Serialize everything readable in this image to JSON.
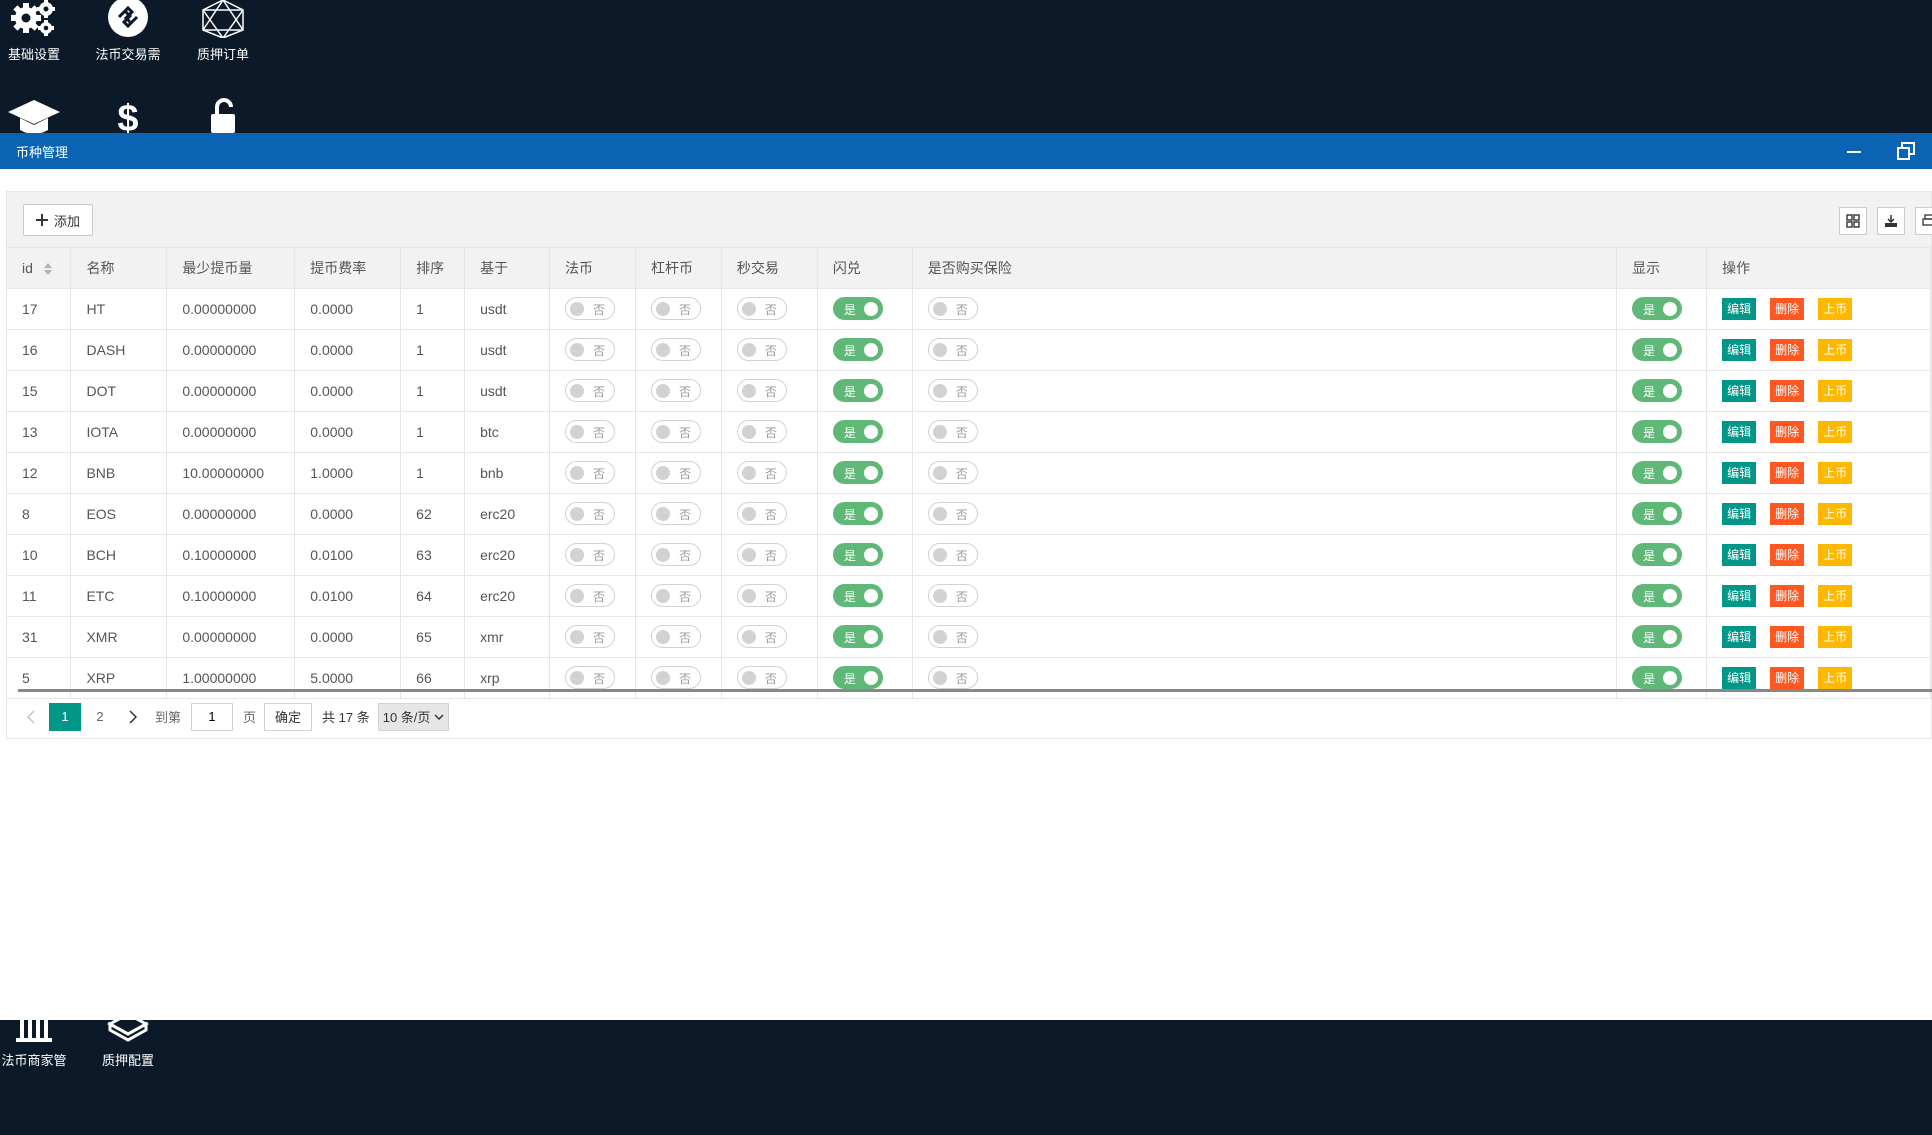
{
  "desktop": {
    "top_icons": [
      {
        "label": "基础设置",
        "icon": "gears-icon"
      },
      {
        "label": "法币交易需",
        "icon": "exchange-circle-icon"
      },
      {
        "label": "质押订单",
        "icon": "polygon-net-icon"
      }
    ],
    "second_row_icons": [
      {
        "label": "",
        "icon": "graduation-cap-icon"
      },
      {
        "label": "",
        "icon": "dollar-icon"
      },
      {
        "label": "",
        "icon": "unlock-icon"
      }
    ],
    "bottom_icons": [
      {
        "label": "法币商家管",
        "icon": "bank-icon"
      },
      {
        "label": "质押配置",
        "icon": "codepen-icon"
      }
    ]
  },
  "window": {
    "title": "币种管理",
    "add_label": "添加"
  },
  "table": {
    "columns": [
      "id",
      "名称",
      "最少提币量",
      "提币费率",
      "排序",
      "基于",
      "法币",
      "杠杆币",
      "秒交易",
      "闪兑",
      "是否购买保险",
      "显示",
      "操作"
    ],
    "switch_on": "是",
    "switch_off": "否",
    "actions": {
      "edit": "编辑",
      "delete": "删除",
      "list": "上币"
    },
    "rows": [
      {
        "id": "17",
        "name": "HT",
        "min": "0.00000000",
        "rate": "0.0000",
        "sort": "1",
        "base": "usdt"
      },
      {
        "id": "16",
        "name": "DASH",
        "min": "0.00000000",
        "rate": "0.0000",
        "sort": "1",
        "base": "usdt"
      },
      {
        "id": "15",
        "name": "DOT",
        "min": "0.00000000",
        "rate": "0.0000",
        "sort": "1",
        "base": "usdt"
      },
      {
        "id": "13",
        "name": "IOTA",
        "min": "0.00000000",
        "rate": "0.0000",
        "sort": "1",
        "base": "btc"
      },
      {
        "id": "12",
        "name": "BNB",
        "min": "10.00000000",
        "rate": "1.0000",
        "sort": "1",
        "base": "bnb"
      },
      {
        "id": "8",
        "name": "EOS",
        "min": "0.00000000",
        "rate": "0.0000",
        "sort": "62",
        "base": "erc20"
      },
      {
        "id": "10",
        "name": "BCH",
        "min": "0.10000000",
        "rate": "0.0100",
        "sort": "63",
        "base": "erc20"
      },
      {
        "id": "11",
        "name": "ETC",
        "min": "0.10000000",
        "rate": "0.0100",
        "sort": "64",
        "base": "erc20"
      },
      {
        "id": "31",
        "name": "XMR",
        "min": "0.00000000",
        "rate": "0.0000",
        "sort": "65",
        "base": "xmr"
      },
      {
        "id": "5",
        "name": "XRP",
        "min": "1.00000000",
        "rate": "5.0000",
        "sort": "66",
        "base": "xrp"
      }
    ]
  },
  "pager": {
    "pages": [
      "1",
      "2"
    ],
    "current": "1",
    "goto_label": "到第",
    "page_value": "1",
    "page_unit": "页",
    "confirm": "确定",
    "total": "共 17 条",
    "per_page": "10 条/页"
  }
}
